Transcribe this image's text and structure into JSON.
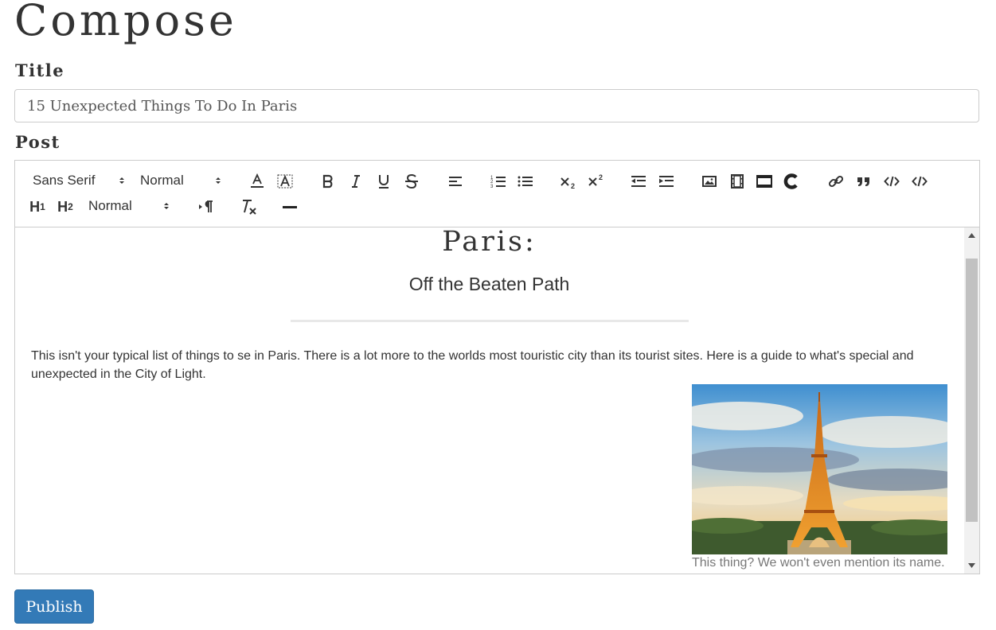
{
  "page": {
    "title": "Compose"
  },
  "form": {
    "title_label": "Title",
    "title_value": "15 Unexpected Things To Do In Paris",
    "post_label": "Post",
    "publish_label": "Publish"
  },
  "toolbar": {
    "font_picker": "Sans Serif",
    "size_picker": "Normal",
    "header_picker": "Normal",
    "header1": "H",
    "header1_sub": "1",
    "header2": "H",
    "header2_sub": "2",
    "icons": [
      "text-color-icon",
      "background-color-icon",
      "bold-icon",
      "italic-icon",
      "underline-icon",
      "strike-icon",
      "align-left-icon",
      "ordered-list-icon",
      "bullet-list-icon",
      "subscript-icon",
      "superscript-icon",
      "outdent-icon",
      "indent-icon",
      "image-icon",
      "video-icon",
      "formula-icon",
      "clean-c-icon",
      "link-icon",
      "blockquote-icon",
      "code-icon",
      "code-block-icon",
      "rtl-direction-icon",
      "clear-format-icon",
      "divider-icon"
    ]
  },
  "post": {
    "heading": "Paris:",
    "subheading": "Off the Beaten Path",
    "paragraph": "This isn't your typical list of things to se in Paris. There is a lot more to the worlds most touristic city than its tourist sites. Here is a guide to what's special and unexpected in the City of Light.",
    "image_caption": "This thing? We won't even mention its name."
  },
  "colors": {
    "primary_button": "#337ab7",
    "border": "#cccccc",
    "text": "#333333"
  }
}
